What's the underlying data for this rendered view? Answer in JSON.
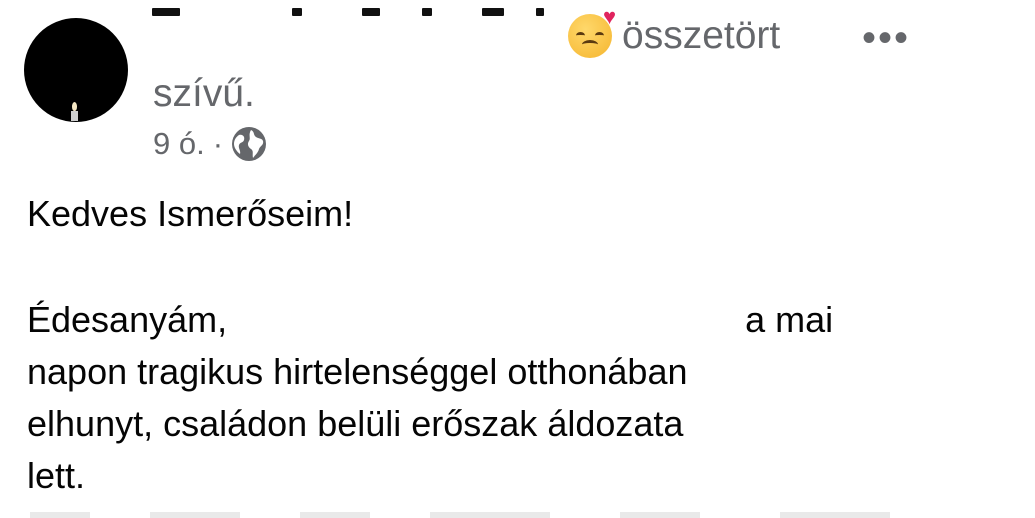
{
  "post": {
    "author_name": "",
    "feeling_text": "összetört",
    "feeling_text_cont": "szívű.",
    "feeling_emoji": "broken-heart-sad-face-emoji",
    "time": "9 ó.",
    "separator": "·",
    "privacy_icon": "globe-icon",
    "more_icon": "•••",
    "greeting": "Kedves Ismerőseim!",
    "body_lines": {
      "line1_start": "Édesanyám,",
      "line1_end": "a mai",
      "line2": "napon tragikus hirtelenséggel otthonában",
      "line3": "elhunyt, családon belüli erőszak áldozata",
      "line4": "lett."
    }
  },
  "colors": {
    "text_primary": "#050505",
    "text_secondary": "#65676b",
    "avatar_bg": "#000000"
  }
}
